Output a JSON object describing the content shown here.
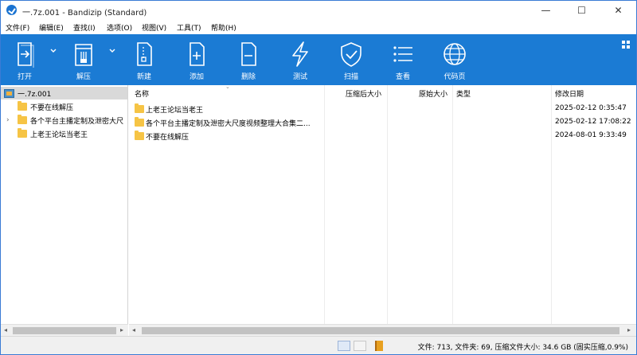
{
  "window": {
    "title": "一.7z.001 - Bandizip (Standard)",
    "controls": {
      "minimize": "—",
      "maximize": "☐",
      "close": "✕"
    }
  },
  "menu": [
    "文件(F)",
    "编辑(E)",
    "查找(I)",
    "选项(O)",
    "视图(V)",
    "工具(T)",
    "帮助(H)"
  ],
  "toolbar": {
    "items": [
      {
        "label": "打开",
        "icon": "open-icon"
      },
      {
        "label": "解压",
        "icon": "extract-icon"
      },
      {
        "label": "新建",
        "icon": "new-archive-icon"
      },
      {
        "label": "添加",
        "icon": "add-file-icon"
      },
      {
        "label": "删除",
        "icon": "delete-file-icon"
      },
      {
        "label": "测试",
        "icon": "test-icon"
      },
      {
        "label": "扫描",
        "icon": "scan-shield-icon"
      },
      {
        "label": "查看",
        "icon": "view-list-icon"
      },
      {
        "label": "代码页",
        "icon": "codepage-globe-icon"
      }
    ],
    "accent": "#1b7bd4"
  },
  "tree": {
    "root": "一.7z.001",
    "items": [
      {
        "label": "不要在线解压",
        "expandable": false
      },
      {
        "label": "各个平台主播定制及泄密大尺",
        "expandable": true
      },
      {
        "label": "上老王论坛当老王",
        "expandable": false
      }
    ]
  },
  "list": {
    "columns": {
      "name": "名称",
      "compressed": "压缩后大小",
      "original": "原始大小",
      "type": "类型",
      "modified": "修改日期"
    },
    "rows": [
      {
        "name": "上老王论坛当老王",
        "modified": "2025-02-12 0:35:47"
      },
      {
        "name": "各个平台主播定制及泄密大尺度视频整理大合集二...",
        "modified": "2025-02-12 17:08:22"
      },
      {
        "name": "不要在线解压",
        "modified": "2024-08-01 9:33:49"
      }
    ]
  },
  "status": {
    "text": "文件: 713, 文件夹: 69, 压缩文件大小: 34.6 GB (固实压缩,0.9%)"
  },
  "colors": {
    "folder": "#f6c445",
    "tree_selected": "#d9d9d9"
  }
}
